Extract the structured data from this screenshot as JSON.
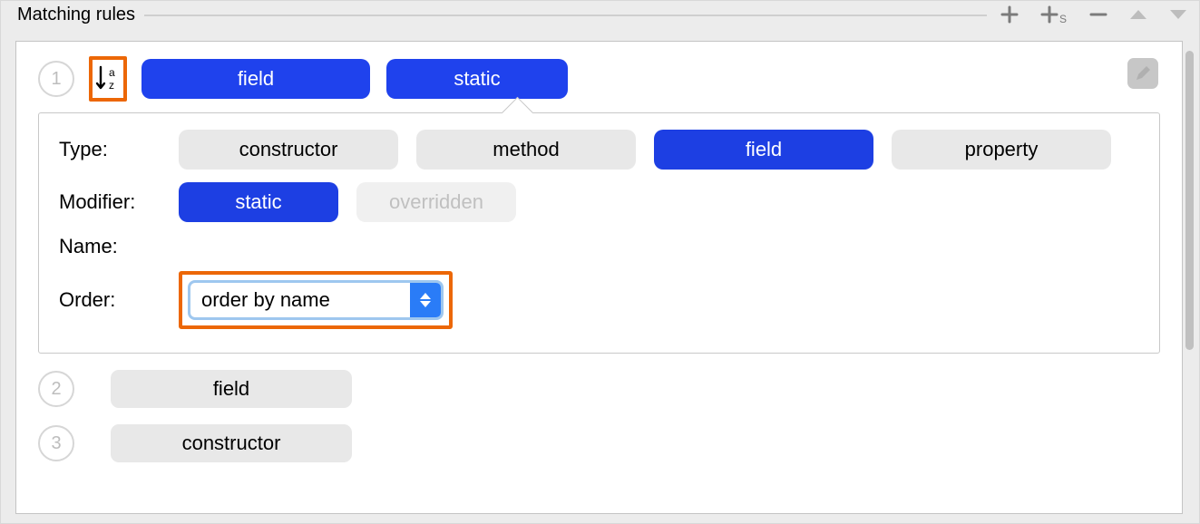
{
  "section": {
    "title": "Matching rules"
  },
  "toolbar_icons": {
    "add": "add-icon",
    "add_section": "add-section-icon",
    "remove": "remove-icon",
    "up": "move-up-icon",
    "down": "move-down-icon"
  },
  "rules": [
    {
      "index": "1",
      "sorted_by_name": true,
      "chips": [
        "field",
        "static"
      ],
      "expanded": true,
      "detail": {
        "labels": {
          "type": "Type:",
          "modifier": "Modifier:",
          "name": "Name:",
          "order": "Order:"
        },
        "type_options": [
          {
            "text": "constructor",
            "sel": false
          },
          {
            "text": "method",
            "sel": false
          },
          {
            "text": "field",
            "sel": true
          },
          {
            "text": "property",
            "sel": false
          }
        ],
        "modifier_options": [
          {
            "text": "static",
            "sel": true
          },
          {
            "text": "overridden",
            "sel": false,
            "disabled": true
          }
        ],
        "order_value": "order by name"
      }
    },
    {
      "index": "2",
      "chip": "field"
    },
    {
      "index": "3",
      "chip": "constructor"
    }
  ]
}
